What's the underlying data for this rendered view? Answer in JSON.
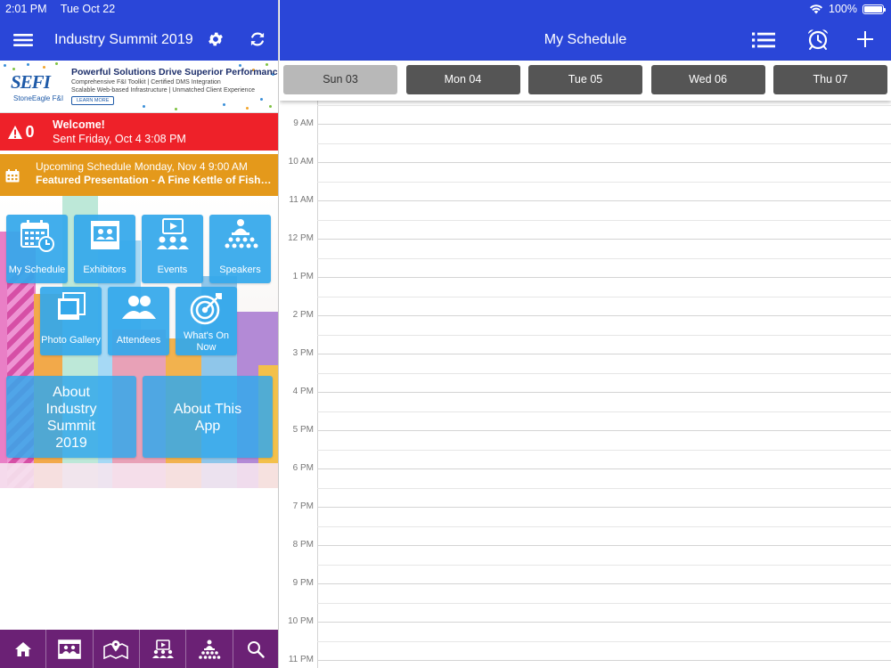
{
  "status_bar": {
    "time": "2:01 PM",
    "date": "Tue Oct 22",
    "battery": "100%",
    "battery_level": 1.0
  },
  "left_header": {
    "title": "Industry Summit 2019"
  },
  "banner": {
    "logo_text": "SEFI",
    "logo_sub": "StoneEagle F&I",
    "headline": "Powerful Solutions Drive Superior Performance",
    "line1": "Comprehensive F&I Toolkit  |  Certified DMS Integration",
    "line2": "Scalable Web-based Infrastructure  |  Unmatched Client Experience",
    "button": "LEARN MORE"
  },
  "alert": {
    "count": "0",
    "title": "Welcome!",
    "subtitle": "Sent Friday, Oct 4 3:08 PM"
  },
  "upcoming": {
    "line1": "Upcoming Schedule Monday, Nov 4 9:00 AM",
    "line2": "Featured Presentation - A Fine Kettle of Fish:..."
  },
  "tiles": {
    "my_schedule": "My Schedule",
    "exhibitors": "Exhibitors",
    "events": "Events",
    "speakers": "Speakers",
    "photo_gallery": "Photo Gallery",
    "attendees": "Attendees",
    "whats_on_now": "What's On Now",
    "about_summit": "About Industry Summit 2019",
    "about_app": "About This App"
  },
  "tabbar_icons": [
    "home-icon",
    "exhibitors-icon",
    "map-icon",
    "events-icon",
    "speakers-icon",
    "search-icon"
  ],
  "right_header": {
    "title": "My Schedule"
  },
  "days": [
    {
      "label": "Sun 03",
      "selected": true
    },
    {
      "label": "Mon 04",
      "selected": false
    },
    {
      "label": "Tue 05",
      "selected": false
    },
    {
      "label": "Wed 06",
      "selected": false
    },
    {
      "label": "Thu 07",
      "selected": false
    }
  ],
  "hours": [
    "9 AM",
    "10 AM",
    "11 AM",
    "12 PM",
    "1 PM",
    "2 PM",
    "3 PM",
    "4 PM",
    "5 PM",
    "6 PM",
    "7 PM",
    "8 PM",
    "9 PM",
    "10 PM",
    "11 PM"
  ],
  "colors": {
    "header_blue": "#2a46d8",
    "alert_red": "#ee2129",
    "upcoming_orange": "#e4991b",
    "tile_blue": "#34a8eb",
    "tabbar_purple": "#6b2175",
    "day_tab": "#555555",
    "day_tab_selected": "#b8b8b8"
  }
}
